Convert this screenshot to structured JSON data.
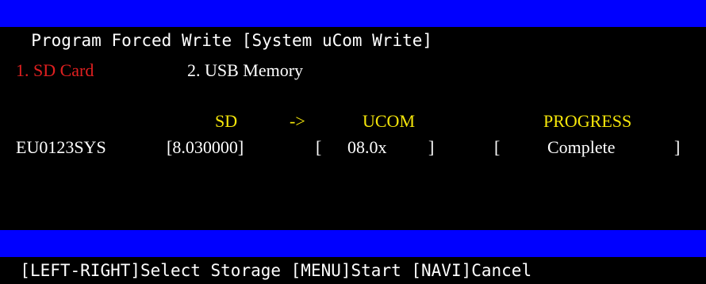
{
  "title": "Program Forced Write [System uCom Write]",
  "storage_options": [
    {
      "label": "1. SD Card",
      "selected": true
    },
    {
      "label": "2. USB Memory",
      "selected": false
    }
  ],
  "columns": {
    "sd": "SD",
    "arrow": "->",
    "ucom": "UCOM",
    "progress": "PROGRESS"
  },
  "row": {
    "name": "EU0123SYS",
    "sd_version": "[8.030000]",
    "ucom_open": "[",
    "ucom_version": "08.0x",
    "ucom_close": "]",
    "progress_open": "[",
    "progress_status": "Complete",
    "progress_close": "]"
  },
  "footer": "[LEFT-RIGHT]Select Storage [MENU]Start [NAVI]Cancel",
  "colors": {
    "bar_bg": "#0000ff",
    "selected": "#e02020",
    "header": "#f5e60a",
    "text": "#ffffff",
    "background": "#000000"
  }
}
